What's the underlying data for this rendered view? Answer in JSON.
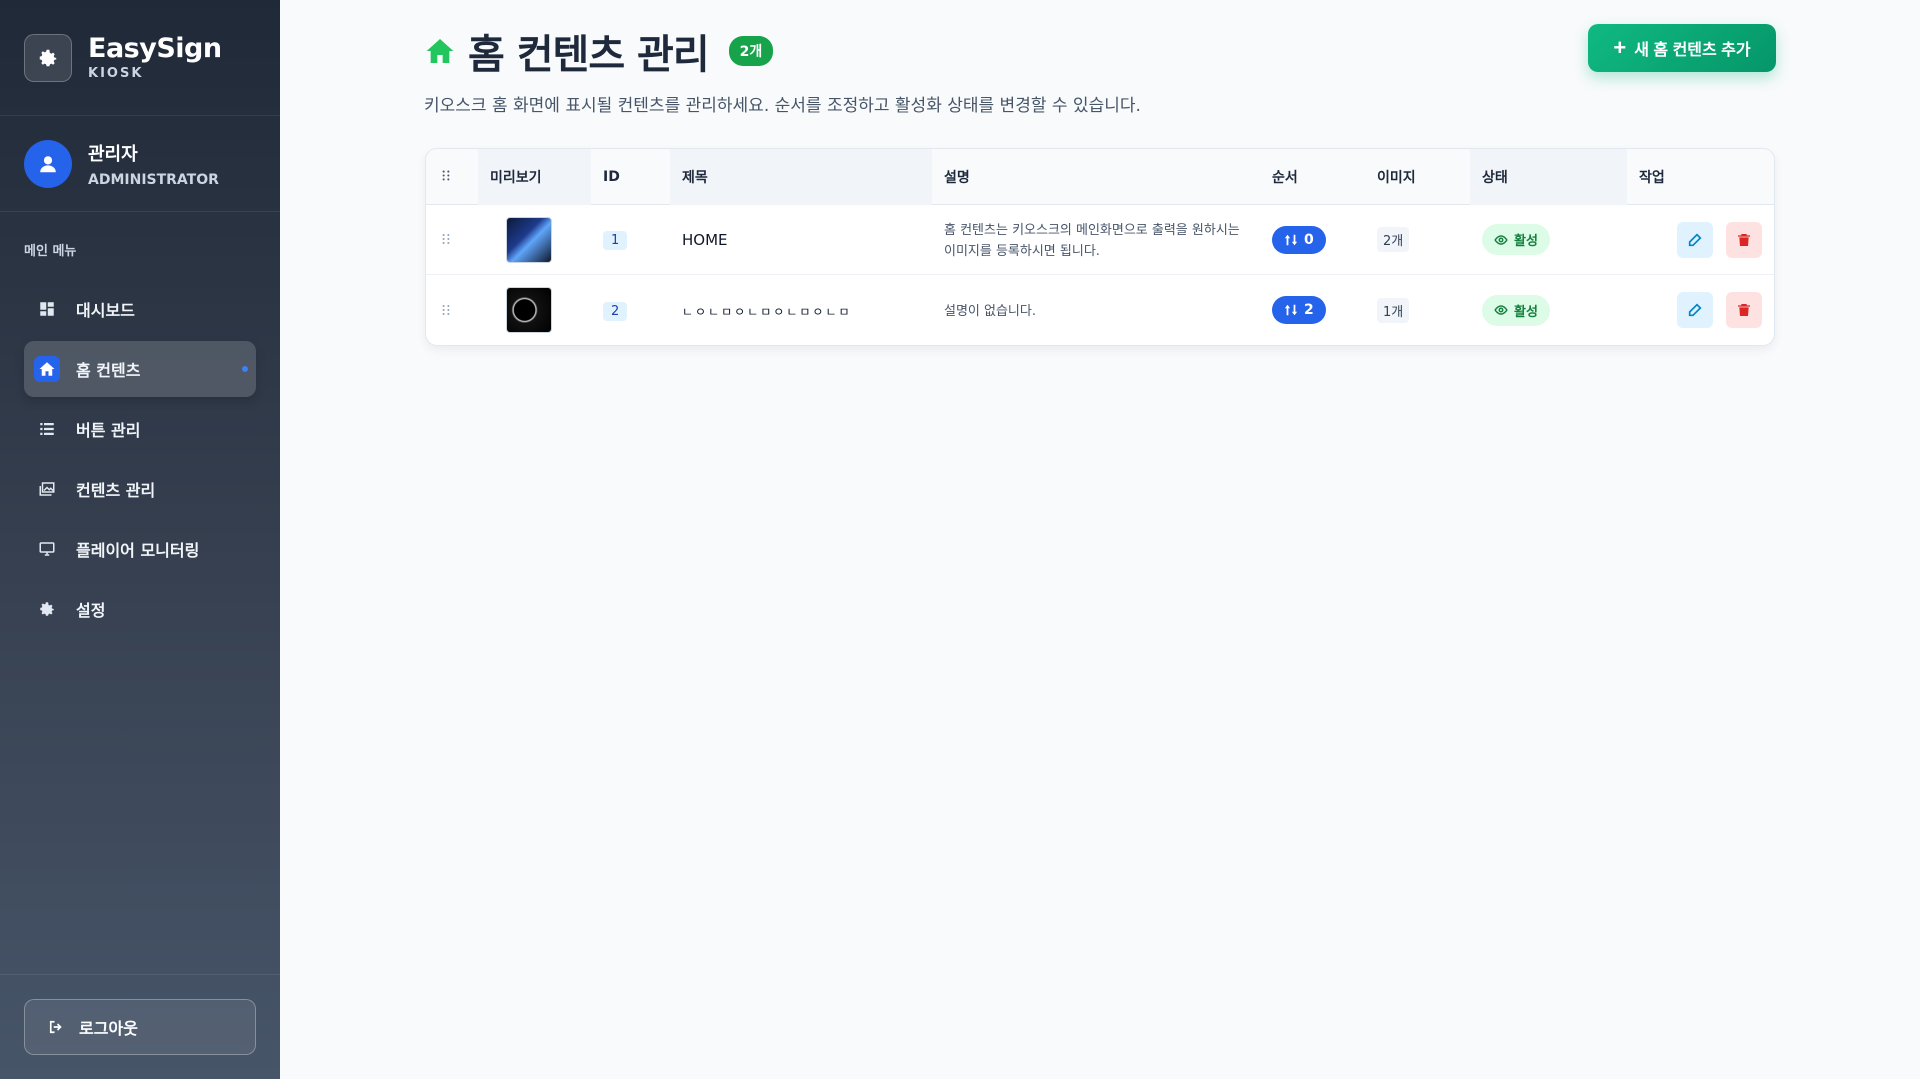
{
  "brand": {
    "name": "EasySign",
    "sub": "KIOSK"
  },
  "user": {
    "name": "관리자",
    "role": "ADMINISTRATOR"
  },
  "menu_title": "메인 메뉴",
  "menu": [
    {
      "label": "대시보드",
      "icon": "dashboard-icon"
    },
    {
      "label": "홈 컨텐츠",
      "icon": "home-icon",
      "active": true
    },
    {
      "label": "버튼 관리",
      "icon": "list-icon"
    },
    {
      "label": "컨텐츠 관리",
      "icon": "images-icon"
    },
    {
      "label": "플레이어 모니터링",
      "icon": "monitor-icon"
    },
    {
      "label": "설정",
      "icon": "gear-icon"
    }
  ],
  "logout_label": "로그아웃",
  "page": {
    "title": "홈 컨텐츠 관리",
    "count": "2개",
    "subtitle": "키오스크 홈 화면에 표시될 컨텐츠를 관리하세요. 순서를 조정하고 활성화 상태를 변경할 수 있습니다.",
    "add_button": "새 홈 컨텐츠 추가"
  },
  "table": {
    "headers": {
      "preview": "미리보기",
      "id": "ID",
      "title": "제목",
      "desc": "설명",
      "order": "순서",
      "images": "이미지",
      "status": "상태",
      "actions": "작업"
    },
    "rows": [
      {
        "id": "1",
        "title": "HOME",
        "desc": "홈 컨텐츠는 키오스크의 메인화면으로 출력을 원하시는 이미지를 등록하시면 됩니다.",
        "order": "0",
        "images": "2개",
        "status": "활성"
      },
      {
        "id": "2",
        "title": "ㄴㅇㄴㅁㅇㄴㅁㅇㄴㅁㅇㄴㅁ",
        "desc": "설명이 없습니다.",
        "order": "2",
        "images": "1개",
        "status": "활성"
      }
    ]
  },
  "colors": {
    "accent": "#2563eb",
    "success": "#10b981",
    "danger": "#dc2626"
  }
}
